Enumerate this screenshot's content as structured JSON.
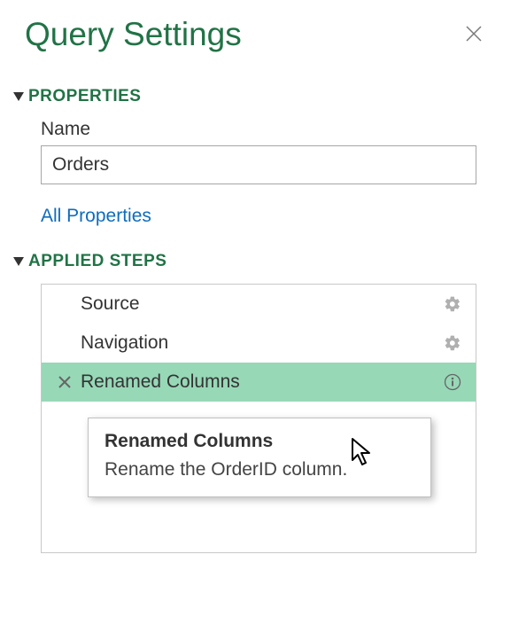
{
  "panel": {
    "title": "Query Settings"
  },
  "properties": {
    "section_label": "PROPERTIES",
    "name_label": "Name",
    "name_value": "Orders",
    "all_properties_link": "All Properties"
  },
  "applied_steps": {
    "section_label": "APPLIED STEPS",
    "steps": [
      {
        "label": "Source",
        "has_gear": true,
        "selected": false,
        "has_delete": false,
        "has_info": false
      },
      {
        "label": "Navigation",
        "has_gear": true,
        "selected": false,
        "has_delete": false,
        "has_info": false
      },
      {
        "label": "Renamed Columns",
        "has_gear": false,
        "selected": true,
        "has_delete": true,
        "has_info": true
      }
    ]
  },
  "tooltip": {
    "title": "Renamed Columns",
    "body": "Rename the OrderID column."
  }
}
